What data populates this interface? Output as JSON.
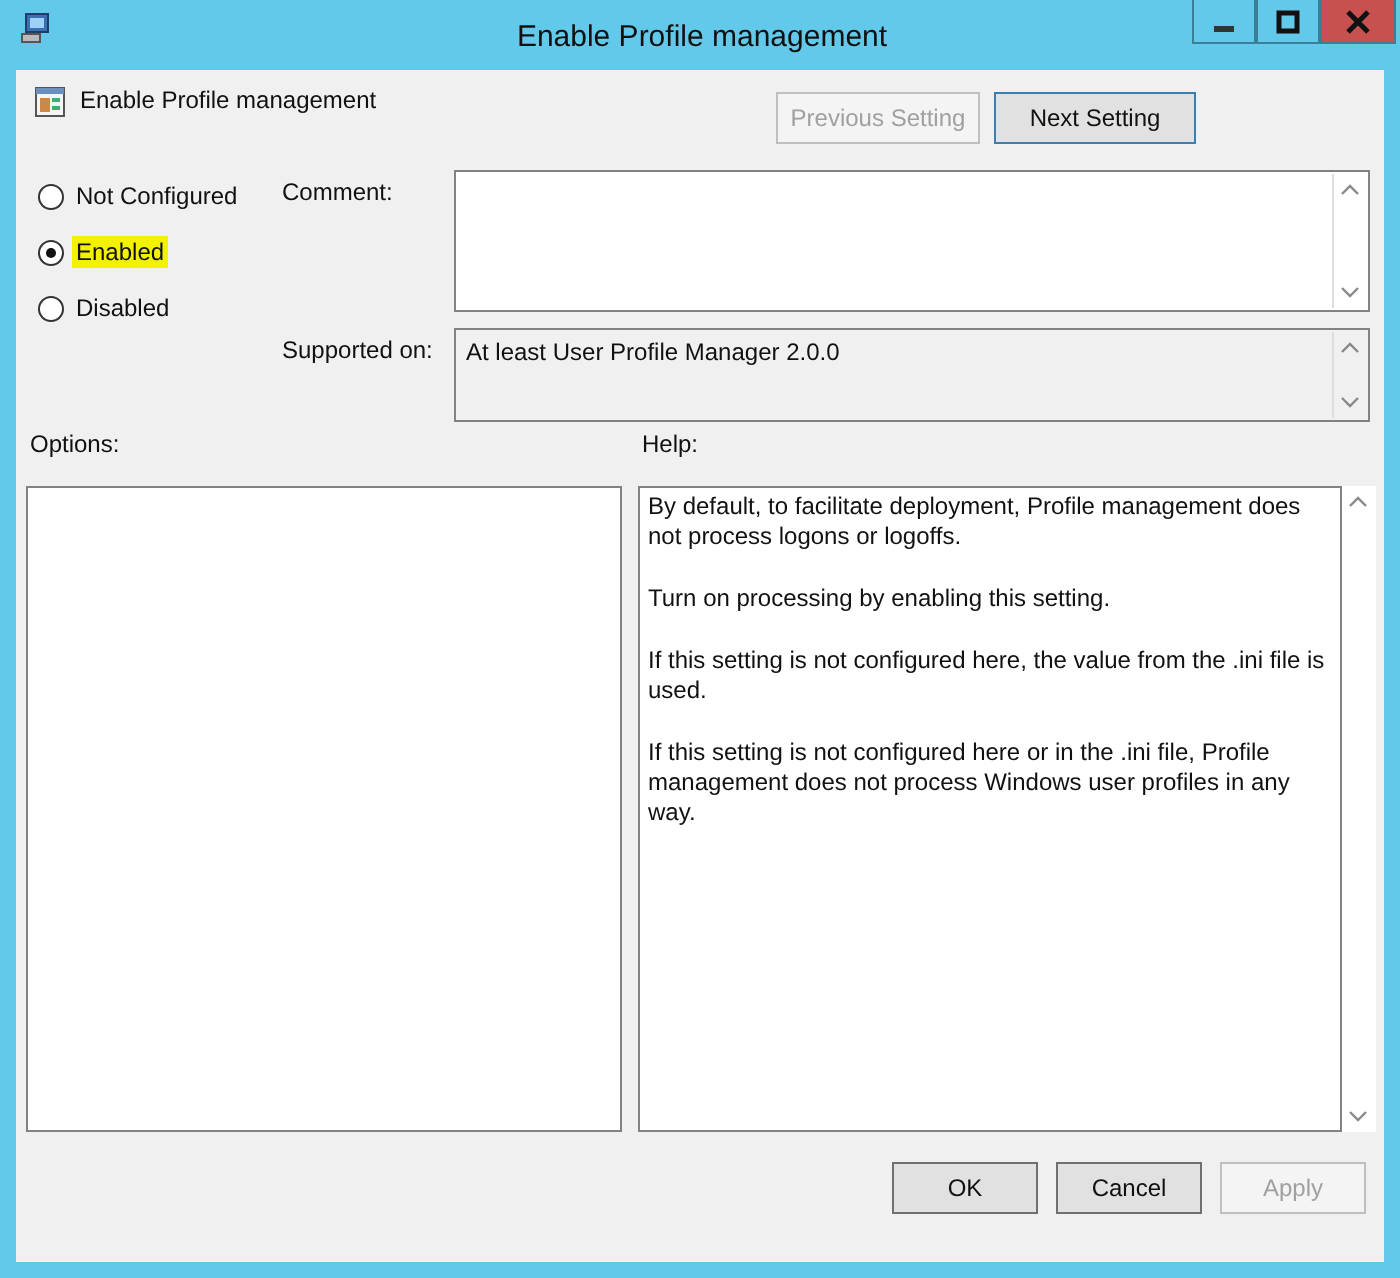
{
  "window": {
    "title": "Enable Profile management"
  },
  "header": {
    "setting_name": "Enable Profile management"
  },
  "nav_buttons": [
    {
      "label": "Previous Setting",
      "disabled": true
    },
    {
      "label": "Next Setting",
      "disabled": false
    }
  ],
  "states": [
    {
      "label": "Not Configured",
      "selected": false,
      "highlighted": false
    },
    {
      "label": "Enabled",
      "selected": true,
      "highlighted": true
    },
    {
      "label": "Disabled",
      "selected": false,
      "highlighted": false
    }
  ],
  "comment": {
    "label": "Comment:"
  },
  "supported_on": {
    "label": "Supported on:",
    "value": "At least User Profile Manager 2.0.0"
  },
  "options": {
    "label": "Options:"
  },
  "help": {
    "label": "Help:",
    "paragraphs": [
      "By default, to facilitate deployment, Profile management does not process logons or logoffs.",
      "Turn on processing by enabling this setting.",
      "If this setting is not configured here, the value from the .ini file is used.",
      "If this setting is not configured here or in the .ini file, Profile management does not process Windows user profiles in any way."
    ]
  },
  "buttons": [
    {
      "label": "OK",
      "disabled": false
    },
    {
      "label": "Cancel",
      "disabled": false
    },
    {
      "label": "Apply",
      "disabled": true
    }
  ]
}
